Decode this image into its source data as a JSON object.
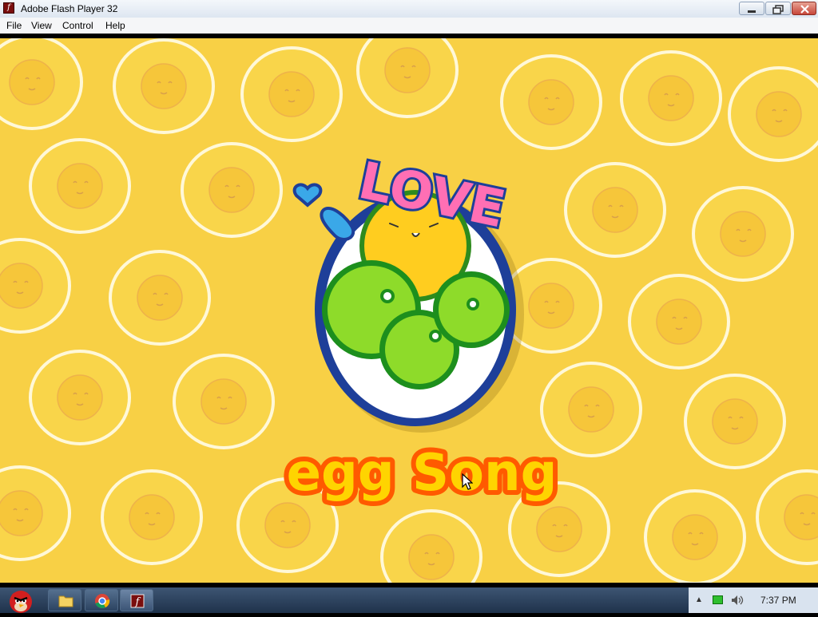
{
  "window": {
    "title": "Adobe Flash Player 32"
  },
  "menu": {
    "items": [
      "File",
      "View",
      "Control",
      "Help"
    ]
  },
  "stage": {
    "logo_top_text": "LOVE",
    "logo_main_text": "egg",
    "song_title": "egg Song",
    "colors": {
      "background": "#f8d045",
      "pink": "#ff6fb4",
      "green": "#7ed321",
      "blue": "#1e3f99",
      "yellow": "#ffd400",
      "orange": "#ff5a00"
    }
  },
  "taskbar": {
    "start_icon": "angry-bird-icon",
    "pinned": [
      "folder-icon",
      "chrome-icon",
      "flash-icon"
    ],
    "clock": "7:37 PM"
  }
}
